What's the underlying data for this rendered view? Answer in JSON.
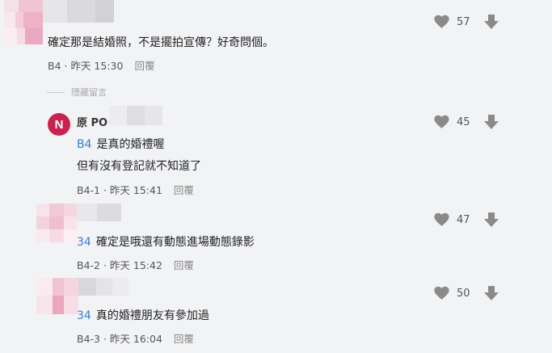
{
  "comments": [
    {
      "floor": "B4",
      "time": "昨天 15:30",
      "reply": "回覆",
      "text_lines": [
        "確定那是結婚照，不是擺拍宣傳？好奇問個。"
      ],
      "likes": "57"
    }
  ],
  "hidden_label": "隱藏留言",
  "replies": [
    {
      "avatar_letter": "N",
      "author": "原 PO ·",
      "tag": "B4",
      "text_lines": [
        "是真的婚禮喔",
        "但有沒有登記就不知道了"
      ],
      "floor": "B4-1",
      "time": "昨天 15:41",
      "reply": "回覆",
      "likes": "45"
    },
    {
      "tag": "34",
      "text_lines": [
        "確定是哦還有動態進場動態錄影"
      ],
      "floor": "B4-2",
      "time": "昨天 15:42",
      "reply": "回覆",
      "likes": "47"
    },
    {
      "tag": "34",
      "text_lines": [
        "真的婚禮朋友有參加過"
      ],
      "floor": "B4-3",
      "time": "昨天 16:04",
      "reply": "回覆",
      "likes": "50"
    }
  ],
  "icons": {
    "heart": "heart-icon",
    "downvote": "downvote-arrow-icon"
  },
  "colors": {
    "background": "#f2f3f5",
    "tag_blue": "#3b7bd1",
    "avatar_red": "#c8234f",
    "icon_gray": "#8a8a8a"
  }
}
